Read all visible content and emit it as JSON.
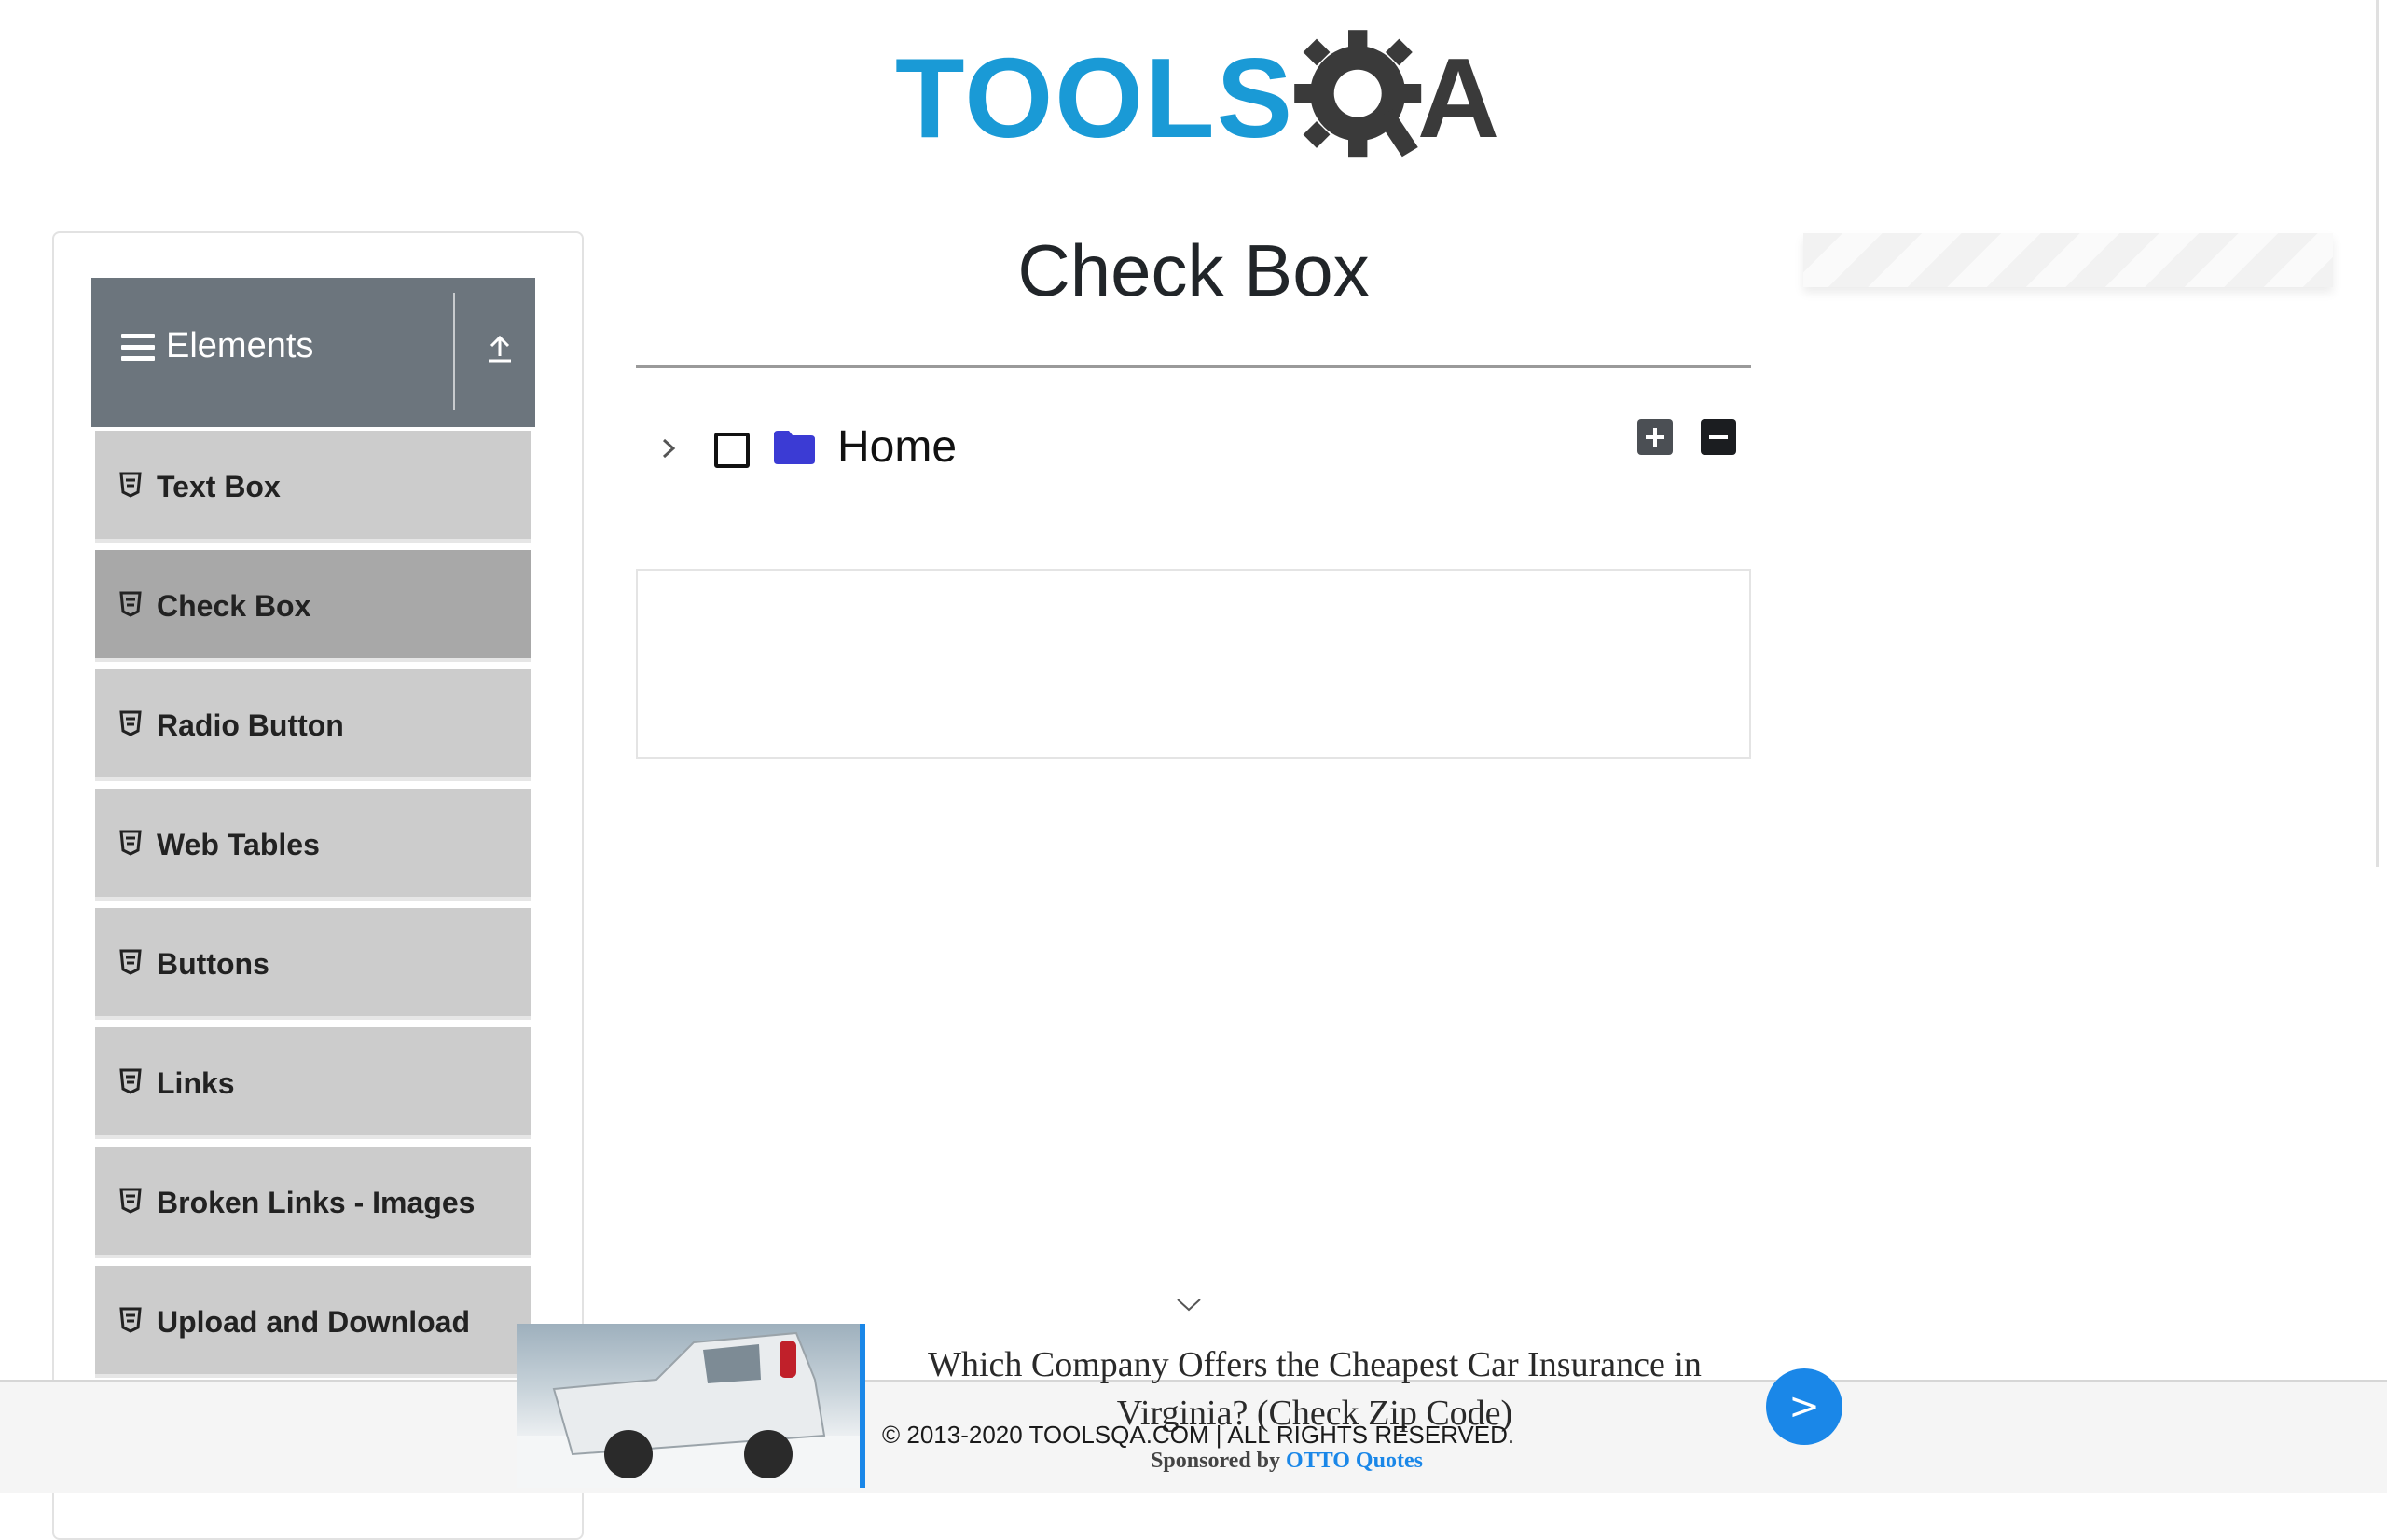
{
  "logo": {
    "part1": "TOOLS",
    "part2": "A",
    "colors": {
      "tools": "#1a9ad6",
      "qa": "#3a3a3a"
    }
  },
  "sidebar": {
    "group_title": "Elements",
    "header_color": "#6c757d",
    "items": [
      {
        "label": "Text Box",
        "active": false
      },
      {
        "label": "Check Box",
        "active": true
      },
      {
        "label": "Radio Button",
        "active": false
      },
      {
        "label": "Web Tables",
        "active": false
      },
      {
        "label": "Buttons",
        "active": false
      },
      {
        "label": "Links",
        "active": false
      },
      {
        "label": "Broken Links - Images",
        "active": false
      },
      {
        "label": "Upload and Download",
        "active": false
      }
    ]
  },
  "main": {
    "title": "Check Box",
    "tree": {
      "root_label": "Home",
      "folder_color": "#3b3bd4"
    }
  },
  "footer": {
    "copyright": "© 2013-2020 TOOLSQA.COM | ALL RIGHTS RESERVED."
  },
  "ad": {
    "headline": "Which Company Offers the Cheapest Car Insurance in Virginia? (Check Zip Code)",
    "sponsored_prefix": "Sponsored by",
    "sponsor_brand": "OTTO Quotes",
    "cta": ">",
    "accent": "#1a87e8"
  }
}
